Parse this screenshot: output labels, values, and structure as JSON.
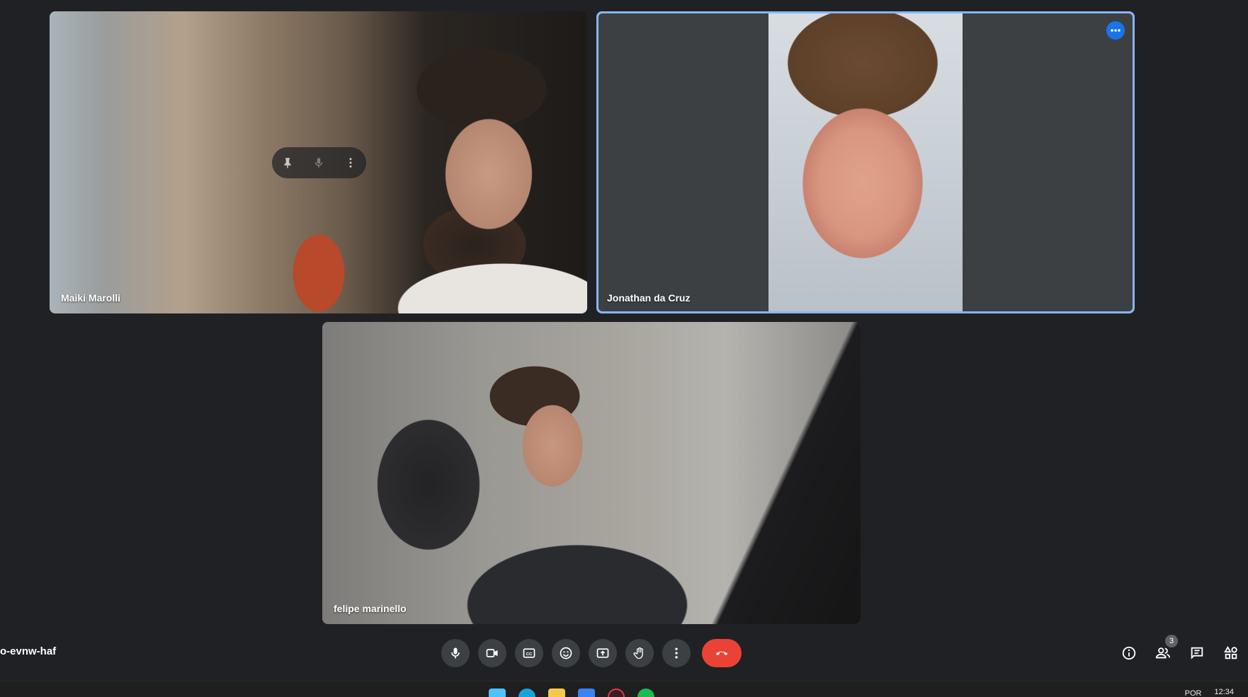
{
  "participants": [
    {
      "name": "Maiki Marolli"
    },
    {
      "name": "Jonathan da Cruz"
    },
    {
      "name": "felipe marinello"
    }
  ],
  "meeting": {
    "code": "o-evnw-haf"
  },
  "controls": {
    "mic_icon": "mic-icon",
    "camera_icon": "videocam-icon",
    "captions_icon": "closed-captions-icon",
    "reactions_icon": "emoji-icon",
    "present_icon": "present-screen-icon",
    "hand_icon": "raise-hand-icon",
    "more_icon": "more-vert-icon",
    "end_call_icon": "call-end-icon",
    "end_call_color": "#ea4335"
  },
  "side_controls": {
    "info_icon": "info-icon",
    "people_icon": "people-icon",
    "people_count": "3",
    "chat_icon": "chat-icon",
    "activities_icon": "activities-icon"
  },
  "taskbar": {
    "language": "POR",
    "time": "12:34",
    "apps": [
      "windows-start-icon",
      "edge-icon",
      "file-explorer-icon",
      "store-icon",
      "opera-icon",
      "spotify-icon"
    ]
  },
  "colors": {
    "background": "#202124",
    "active_speaker_border": "#8ab4f8",
    "accent": "#1a73e8"
  }
}
